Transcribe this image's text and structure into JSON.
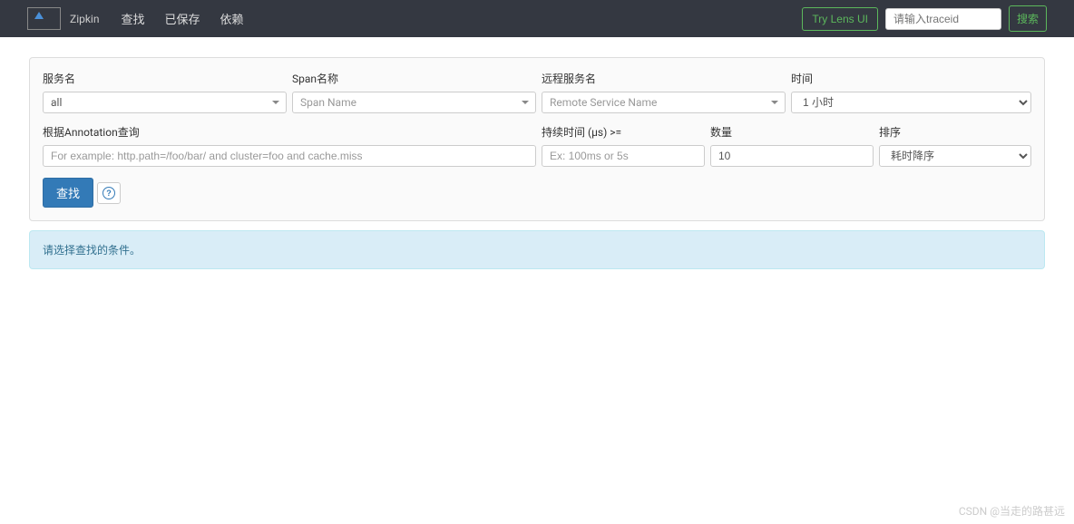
{
  "navbar": {
    "brand": "Zipkin",
    "links": [
      "查找",
      "已保存",
      "依赖"
    ],
    "lens_button": "Try Lens UI",
    "traceid_placeholder": "请输入traceid",
    "search_button": "搜索"
  },
  "form": {
    "service_name": {
      "label": "服务名",
      "value": "all"
    },
    "span_name": {
      "label": "Span名称",
      "placeholder": "Span Name"
    },
    "remote_service": {
      "label": "远程服务名",
      "placeholder": "Remote Service Name"
    },
    "time": {
      "label": "时间",
      "value": "1 小时"
    },
    "annotation": {
      "label": "根据Annotation查询",
      "placeholder": "For example: http.path=/foo/bar/ and cluster=foo and cache.miss"
    },
    "duration": {
      "label": "持续时间 (µs) >=",
      "placeholder": "Ex: 100ms or 5s"
    },
    "limit": {
      "label": "数量",
      "value": "10"
    },
    "sort": {
      "label": "排序",
      "value": "耗时降序"
    },
    "submit": "查找"
  },
  "alert": "请选择查找的条件。",
  "watermark": "CSDN @当走的路甚远"
}
